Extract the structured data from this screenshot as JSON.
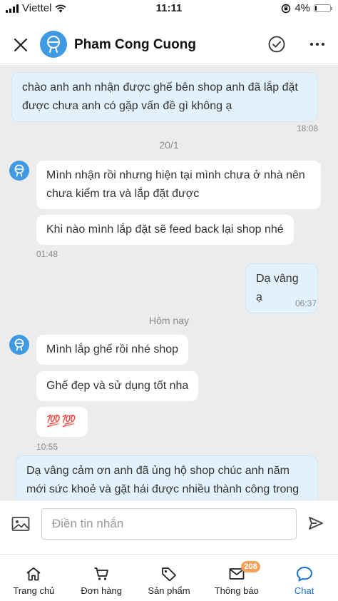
{
  "status_bar": {
    "carrier": "Viettel",
    "time": "11:11",
    "battery": "4%",
    "battery_level": 0.04
  },
  "header": {
    "contact_name": "Pham Cong Cuong",
    "icons": {
      "close": "close-icon",
      "avatar": "avatar-icon",
      "check": "check-circle-icon",
      "more": "more-dots-icon"
    }
  },
  "chat": {
    "messages": [
      {
        "sender": "shop",
        "text": "chào anh anh nhận được ghế bên shop anh đã lắp đặt được chưa anh có gặp vấn đề gì không ạ",
        "time": "18:08"
      },
      {
        "separator": "20/1"
      },
      {
        "sender": "customer",
        "text": "Mình nhận rồi nhưng hiện tại mình chưa ở nhà nên chưa kiểm tra và lắp đặt được"
      },
      {
        "sender": "customer",
        "text": "Khi nào mình lắp đặt sẽ feed back lại shop nhé",
        "time": "01:48"
      },
      {
        "sender": "shop",
        "text": "Dạ vâng ạ",
        "time": "06:37"
      },
      {
        "separator": "Hôm nay"
      },
      {
        "sender": "customer",
        "text": "Mình lắp ghế rồi nhé shop"
      },
      {
        "sender": "customer",
        "text": "Ghế đẹp và sử dụng tốt nha"
      },
      {
        "sender": "customer",
        "text": "💯💯",
        "time": "10:55"
      },
      {
        "sender": "shop",
        "text": "Dạ vâng cảm ơn anh đã ủng hộ shop chúc anh năm mới sức khoẻ và gặt hái được nhiều thành công trong"
      }
    ]
  },
  "composer": {
    "placeholder": "Điền tin nhắn",
    "value": "",
    "icons": {
      "image": "image-icon",
      "send": "send-icon"
    }
  },
  "bottom_nav": {
    "items": [
      {
        "label": "Trang chủ",
        "icon": "home-icon"
      },
      {
        "label": "Đơn hàng",
        "icon": "cart-icon"
      },
      {
        "label": "Sản phẩm",
        "icon": "tag-icon"
      },
      {
        "label": "Thông báo",
        "icon": "mail-icon",
        "badge": "208"
      },
      {
        "label": "Chat",
        "icon": "chat-icon",
        "active": true
      }
    ]
  },
  "colors": {
    "accent": "#1a73c8",
    "avatar": "#3f9ae3",
    "outgoing_bubble": "#e2f1fc",
    "chat_background": "#ececec",
    "badge": "#f0a35b"
  }
}
